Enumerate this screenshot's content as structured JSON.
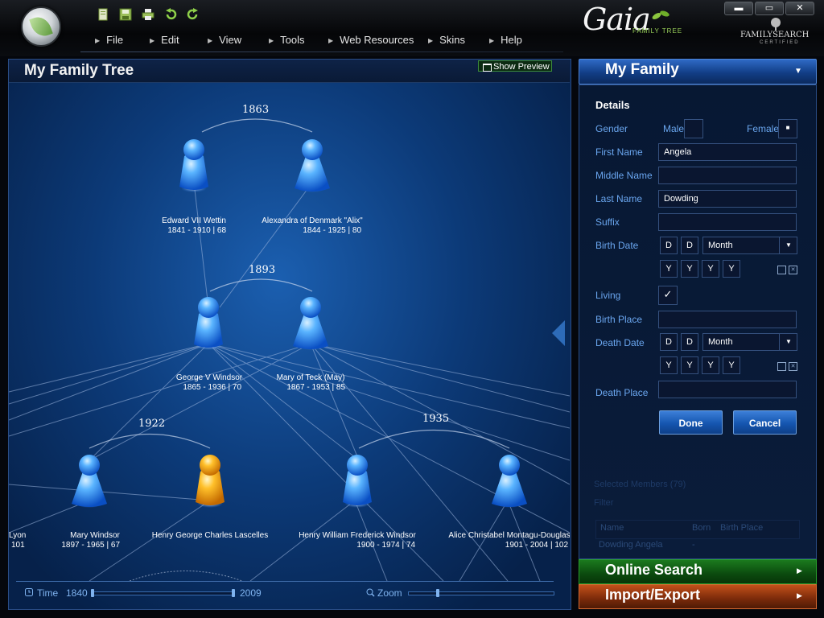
{
  "toolbar": {
    "icons": [
      "new-document-icon",
      "save-icon",
      "print-icon",
      "undo-icon",
      "redo-icon"
    ]
  },
  "menu": {
    "items": [
      {
        "label": "File"
      },
      {
        "label": "Edit"
      },
      {
        "label": "View"
      },
      {
        "label": "Tools"
      },
      {
        "label": "Web Resources"
      },
      {
        "label": "Skins"
      },
      {
        "label": "Help"
      }
    ]
  },
  "brand": {
    "name": "Gaia",
    "tagline": "FAMILY TREE",
    "certifier": "FAMILYSEARCH",
    "certifier_sub": "CERTIFIED"
  },
  "window": {
    "minimize": "▬",
    "maximize": "▭",
    "close": "✕"
  },
  "tree": {
    "title": "My Family Tree",
    "show_preview": "Show Preview",
    "marriages": [
      {
        "year": "1863"
      },
      {
        "year": "1893"
      },
      {
        "year": "1922"
      },
      {
        "year": "1935"
      }
    ],
    "people": [
      {
        "name": "Edward VII Wettin",
        "dates": "1841 - 1910 | 68",
        "gender": "male",
        "selected": false
      },
      {
        "name": "Alexandra of Denmark \"Alix\"",
        "dates": "1844 - 1925 | 80",
        "gender": "female",
        "selected": false
      },
      {
        "name": "George V Windsor",
        "dates": "1865 - 1936 | 70",
        "gender": "male",
        "selected": false
      },
      {
        "name": "Mary of Teck (May)",
        "dates": "1867 - 1953 | 85",
        "gender": "female",
        "selected": false
      },
      {
        "name": "Mary Windsor",
        "dates": "1897 - 1965 | 67",
        "gender": "female",
        "selected": false
      },
      {
        "name": "Henry George Charles Lascelles",
        "dates": "",
        "gender": "male",
        "selected": true
      },
      {
        "name": "Henry William Frederick Windsor",
        "dates": "1900 - 1974 | 74",
        "gender": "male",
        "selected": false
      },
      {
        "name": "Alice Christabel Montagu-Douglas",
        "dates": "1901 - 2004 | 102",
        "gender": "female",
        "selected": false
      },
      {
        "name": "Lyon",
        "dates": "101",
        "gender": "unknown",
        "selected": false
      }
    ]
  },
  "timeline": {
    "label": "Time",
    "start": "1840",
    "end": "2009",
    "zoom_label": "Zoom",
    "zoom_level": 0.2
  },
  "family_panel": {
    "title": "My Family",
    "details_heading": "Details",
    "gender_label": "Gender",
    "male_label": "Male",
    "female_label": "Female",
    "female_checked": "■",
    "first_name_label": "First Name",
    "first_name": "Angela",
    "middle_name_label": "Middle Name",
    "middle_name": "",
    "last_name_label": "Last Name",
    "last_name": "Dowding",
    "suffix_label": "Suffix",
    "suffix": "",
    "birth_date_label": "Birth Date",
    "day_placeholder": "D",
    "month_placeholder": "Month",
    "year_placeholder": "Y",
    "living_label": "Living",
    "living_check": "✓",
    "birth_place_label": "Birth Place",
    "death_date_label": "Death Date",
    "death_place_label": "Death Place",
    "done_label": "Done",
    "cancel_label": "Cancel",
    "selected_members": "Selected Members",
    "selected_count": "(79)",
    "filter_label": "Filter",
    "table_headers": [
      "Name",
      "Born",
      "Birth Place"
    ],
    "table_rows": [
      {
        "name": "Dowding Angela",
        "born": "-"
      }
    ]
  },
  "sections": {
    "online_search": "Online Search",
    "import_export": "Import/Export"
  },
  "colors": {
    "accent": "#2f6ac6",
    "male": "#2a8cf0",
    "female": "#3a90f0",
    "selected": "#f0a820",
    "online": "#1b7a1e",
    "import": "#c2501a"
  }
}
